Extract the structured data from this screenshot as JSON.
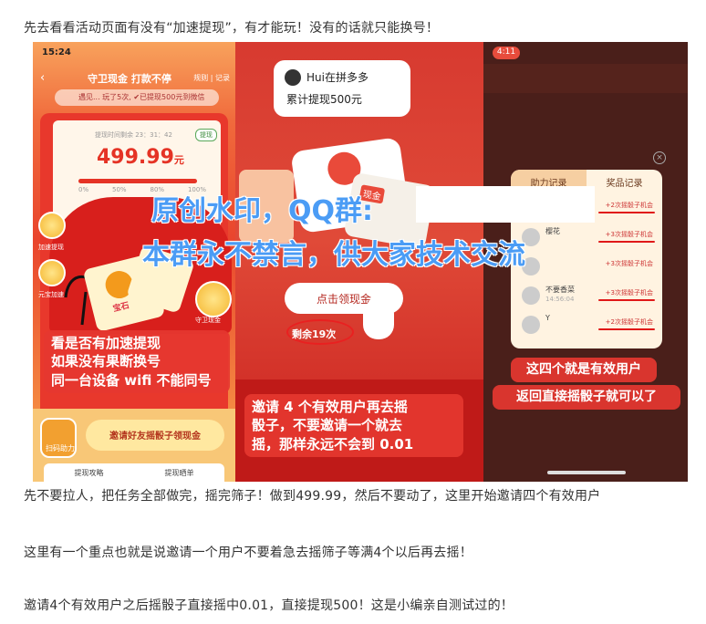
{
  "article": {
    "line1": "先去看看活动页面有没有“加速提现”，有才能玩！没有的话就只能换号！",
    "line2": "先不要拉人，把任务全部做完，摇完筛子！做到499.99，然后不要动了，这里开始邀请四个有效用户",
    "line3": "这里有一个重点也就是说邀请一个用户不要着急去摇筛子等满4个以后再去摇！",
    "line4": "邀请4个有效用户之后摇骰子直接摇中0.01，直接提现500！这是小编亲自测试过的！"
  },
  "watermark": {
    "line1": "原创水印，QQ群:",
    "line2": "本群永不禁言，供大家技术交流"
  },
  "panel1": {
    "status_time": "15:24",
    "title": "守卫现金 打款不停",
    "rule_link": "规则 | 记录",
    "user_bar": "遇见... 玩了5次, ✔已提现500元到微信",
    "time_label": "提现时间剩余 23：31：42",
    "withdraw_badge": "提现",
    "amount": "499.99",
    "amount_unit": "元",
    "progress": 0.999,
    "ticks": [
      "0%",
      "50%",
      "80%",
      "100%"
    ],
    "side_speed_label": "加速提现",
    "side_yuanbao_label": "元宝加速",
    "gem_label": "宝石",
    "guard_label": "守卫现金",
    "annotation": "看是否有加速提现\n如果没有果断换号\n同一台设备 wifi 不能同号",
    "scan_label": "扫码助力",
    "invite_button": "邀请好友摇骰子领现金",
    "tab1": "提现攻略",
    "tab2": "提现晒单"
  },
  "panel2": {
    "user_name": "Hui在拼多多",
    "stat": "累计提现500元",
    "box_label": "现金",
    "claim_button": "点击领现金",
    "remaining": "剩余19次",
    "annotation": "邀请 4 个有效用户再去摇\n骰子，不要邀请一个就去\n摇，那样永远不会到 0.01"
  },
  "panel3": {
    "status_time": "4:11",
    "tab_help": "助力记录",
    "tab_prize": "奖品记录",
    "close": "×",
    "rows": [
      {
        "name": "",
        "time": "",
        "reward": "+2次摇骰子机会"
      },
      {
        "name": "樱花",
        "time": "",
        "reward": "+3次摇骰子机会"
      },
      {
        "name": "",
        "time": "",
        "reward": "+3次摇骰子机会"
      },
      {
        "name": "不要香菜",
        "time": "14:56:04",
        "reward": "+3次摇骰子机会"
      },
      {
        "name": "Y",
        "time": "",
        "reward": "+2次摇骰子机会"
      }
    ],
    "annotation1": "这四个就是有效用户",
    "annotation2": "返回直接摇骰子就可以了"
  }
}
